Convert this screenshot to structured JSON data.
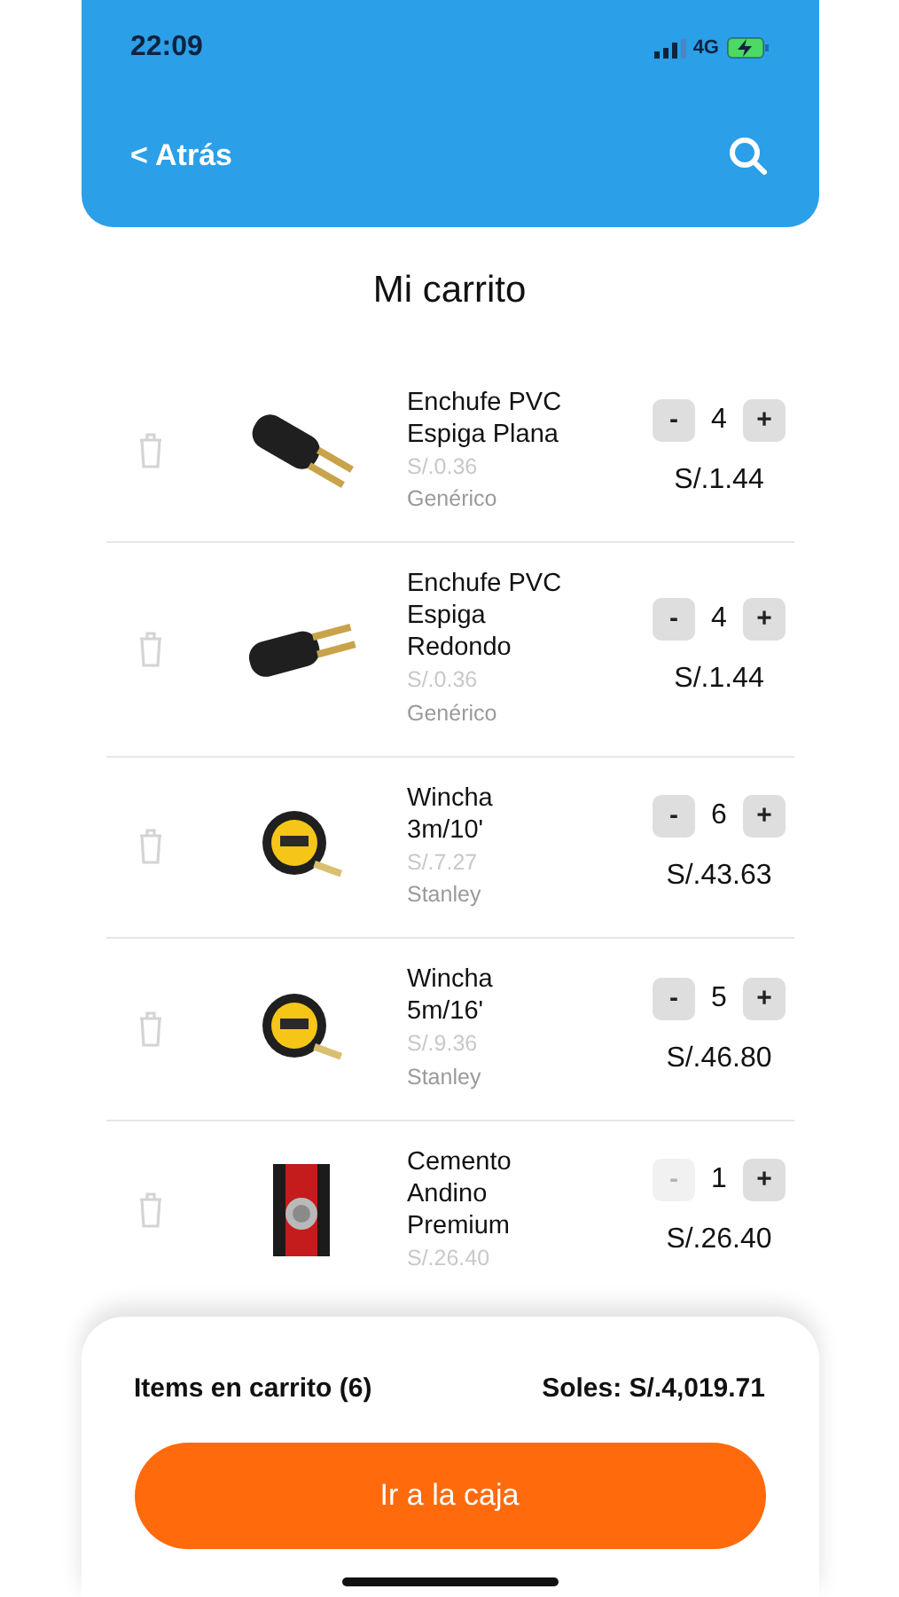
{
  "status_bar": {
    "time": "22:09",
    "network": "4G"
  },
  "nav": {
    "back": "< Atrás"
  },
  "title": "Mi carrito",
  "items": [
    {
      "name": "Enchufe PVC Espiga Plana",
      "unit_price": "S/.0.36",
      "brand": "Genérico",
      "minus": "-",
      "quantity": "4",
      "plus": "+",
      "minus_disabled": false,
      "total": "S/.1.44"
    },
    {
      "name": "Enchufe PVC Espiga Redondo",
      "unit_price": "S/.0.36",
      "brand": "Genérico",
      "minus": "-",
      "quantity": "4",
      "plus": "+",
      "minus_disabled": false,
      "total": "S/.1.44"
    },
    {
      "name": "Wincha 3m/10'",
      "unit_price": "S/.7.27",
      "brand": "Stanley",
      "minus": "-",
      "quantity": "6",
      "plus": "+",
      "minus_disabled": false,
      "total": "S/.43.63"
    },
    {
      "name": "Wincha 5m/16'",
      "unit_price": "S/.9.36",
      "brand": "Stanley",
      "minus": "-",
      "quantity": "5",
      "plus": "+",
      "minus_disabled": false,
      "total": "S/.46.80"
    },
    {
      "name": "Cemento Andino Premium",
      "unit_price": "S/.26.40",
      "minus": "-",
      "quantity": "1",
      "plus": "+",
      "minus_disabled": true,
      "total": "S/.26.40"
    }
  ],
  "footer": {
    "items_count": "Items en carrito (6)",
    "total": "Soles: S/.4,019.71",
    "checkout": "Ir a la caja"
  }
}
